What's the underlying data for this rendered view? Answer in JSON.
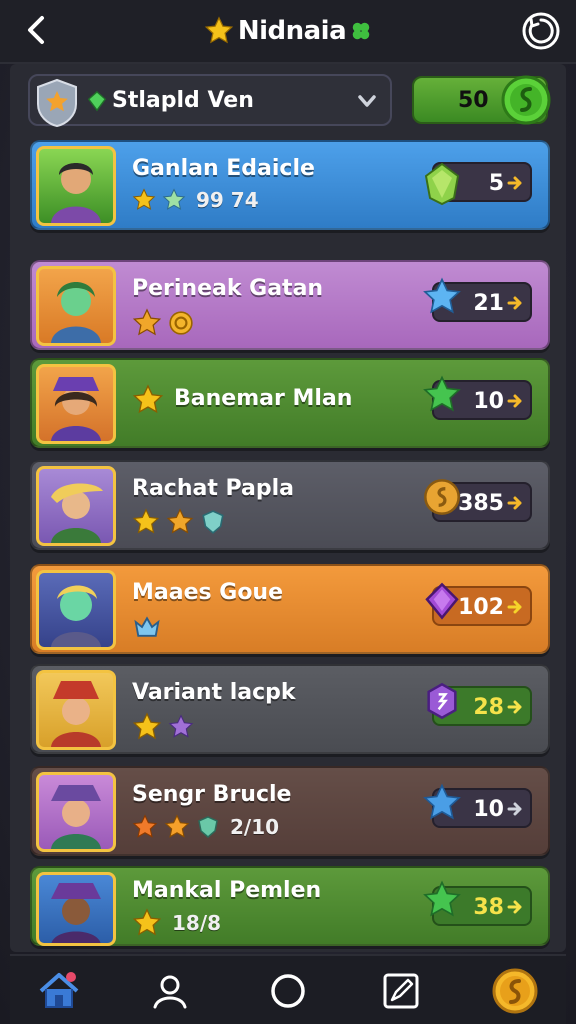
{
  "header": {
    "title": "Nidnaia",
    "title_icon_left": "star-icon",
    "title_icon_right": "clover-icon"
  },
  "filter": {
    "label": "Stlapld Ven",
    "icon": "shield-star-icon"
  },
  "currency": {
    "value": "50",
    "icon": "green-coin-icon"
  },
  "cards": [
    {
      "name": "Ganlan Edaicle",
      "stats": "99 74",
      "reward": "5",
      "bg": "#3a8ad6",
      "reward_icon": "green-gem-icon"
    },
    {
      "name": "Perineak Gatan",
      "stats": "",
      "reward": "21",
      "bg": "#b676c6",
      "reward_icon": "blue-star-icon"
    },
    {
      "name": "Banemar Mlan",
      "stats": "",
      "reward": "10",
      "bg": "#4f8a32",
      "reward_icon": "green-star-icon"
    },
    {
      "name": "Rachat Papla",
      "stats": "",
      "reward": "385",
      "bg": "#55565f",
      "reward_icon": "gold-coin-icon"
    },
    {
      "name": "Maaes Goue",
      "stats": "",
      "reward": "102",
      "bg": "#e08833",
      "reward_icon": "purple-gem-icon"
    },
    {
      "name": "Variant lacpk",
      "stats": "",
      "reward": "28",
      "bg": "#55575c",
      "reward_icon": "purple-hex-gem-icon"
    },
    {
      "name": "Sengr Brucle",
      "stats": "2/10",
      "reward": "10",
      "bg": "#5e4a46",
      "reward_icon": "blue-star-icon"
    },
    {
      "name": "Mankal Pemlen",
      "stats": "18/8",
      "reward": "38",
      "bg": "#4f8a32",
      "reward_icon": "green-star-icon"
    }
  ],
  "nav": [
    "home-icon",
    "profile-icon",
    "circle-icon",
    "edit-icon",
    "gold-coin-icon"
  ]
}
